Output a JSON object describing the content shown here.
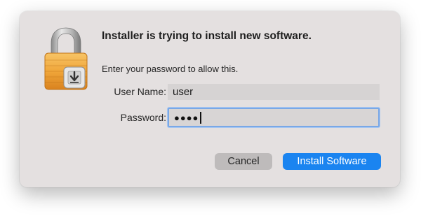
{
  "dialog": {
    "title": "Installer is trying to install new software.",
    "message": "Enter your password to allow this.",
    "icon": "lock-icon"
  },
  "form": {
    "username_label": "User Name:",
    "username_value": "user",
    "password_label": "Password:",
    "password_masked": "●●●●"
  },
  "buttons": {
    "cancel": "Cancel",
    "install": "Install Software"
  },
  "colors": {
    "accent": "#1a84f0",
    "dialog_bg": "#e4e0e0",
    "lock_body": "#f0a63a"
  }
}
